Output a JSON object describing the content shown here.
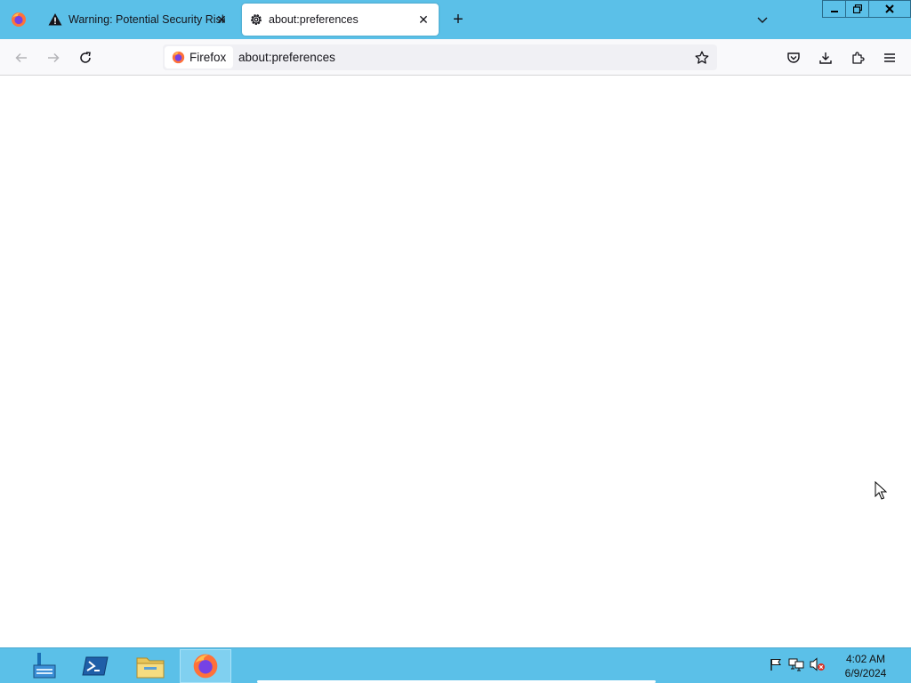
{
  "tabs": [
    {
      "title": "Warning: Potential Security Risk Ahead",
      "icon": "warning-icon",
      "active": false
    },
    {
      "title": "about:preferences",
      "icon": "gear-icon",
      "active": true
    }
  ],
  "urlbar": {
    "identity_label": "Firefox",
    "url": "about:preferences"
  },
  "taskbar": {
    "apps": [
      "server-manager-icon",
      "powershell-icon",
      "file-explorer-icon",
      "firefox-icon"
    ],
    "clock": {
      "time": "4:02 AM",
      "date": "6/9/2024"
    }
  },
  "colors": {
    "chrome": "#5bc0e8",
    "toolbar": "#f9f9fb",
    "urlbar": "#f0f0f4"
  }
}
